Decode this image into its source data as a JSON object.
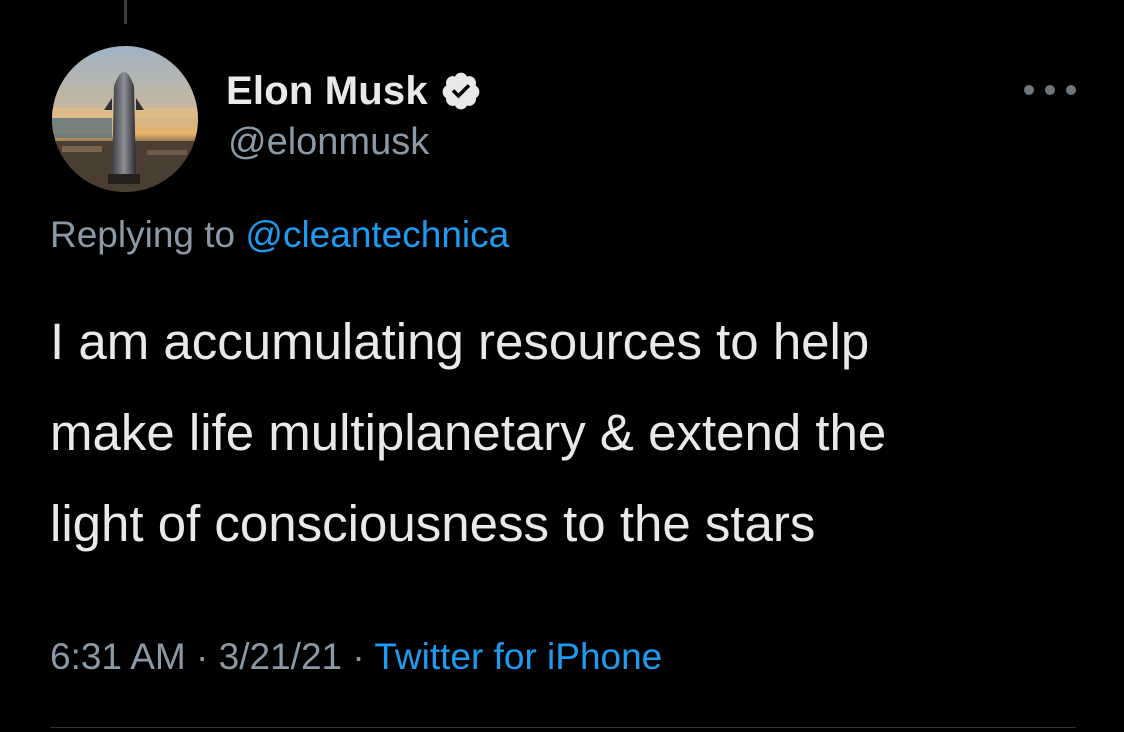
{
  "tweet": {
    "author": {
      "name": "Elon Musk",
      "handle": "@elonmusk",
      "avatar_icon": "starship-photo-avatar",
      "verified_icon": "verified-badge-icon"
    },
    "more_icon": "more-options-icon",
    "replying_to": {
      "label": "Replying to",
      "mention": "@cleantechnica"
    },
    "text_lines": [
      "I am accumulating resources to help",
      "make life multiplanetary & extend the",
      "light of consciousness to the stars"
    ],
    "meta": {
      "time": "6:31 AM",
      "separator": "·",
      "date": "3/21/21",
      "source": "Twitter for iPhone"
    }
  },
  "colors": {
    "background": "#000000",
    "primary_text": "#e7e9ea",
    "secondary_text": "#8b98a5",
    "accent": "#1d9bf0"
  }
}
